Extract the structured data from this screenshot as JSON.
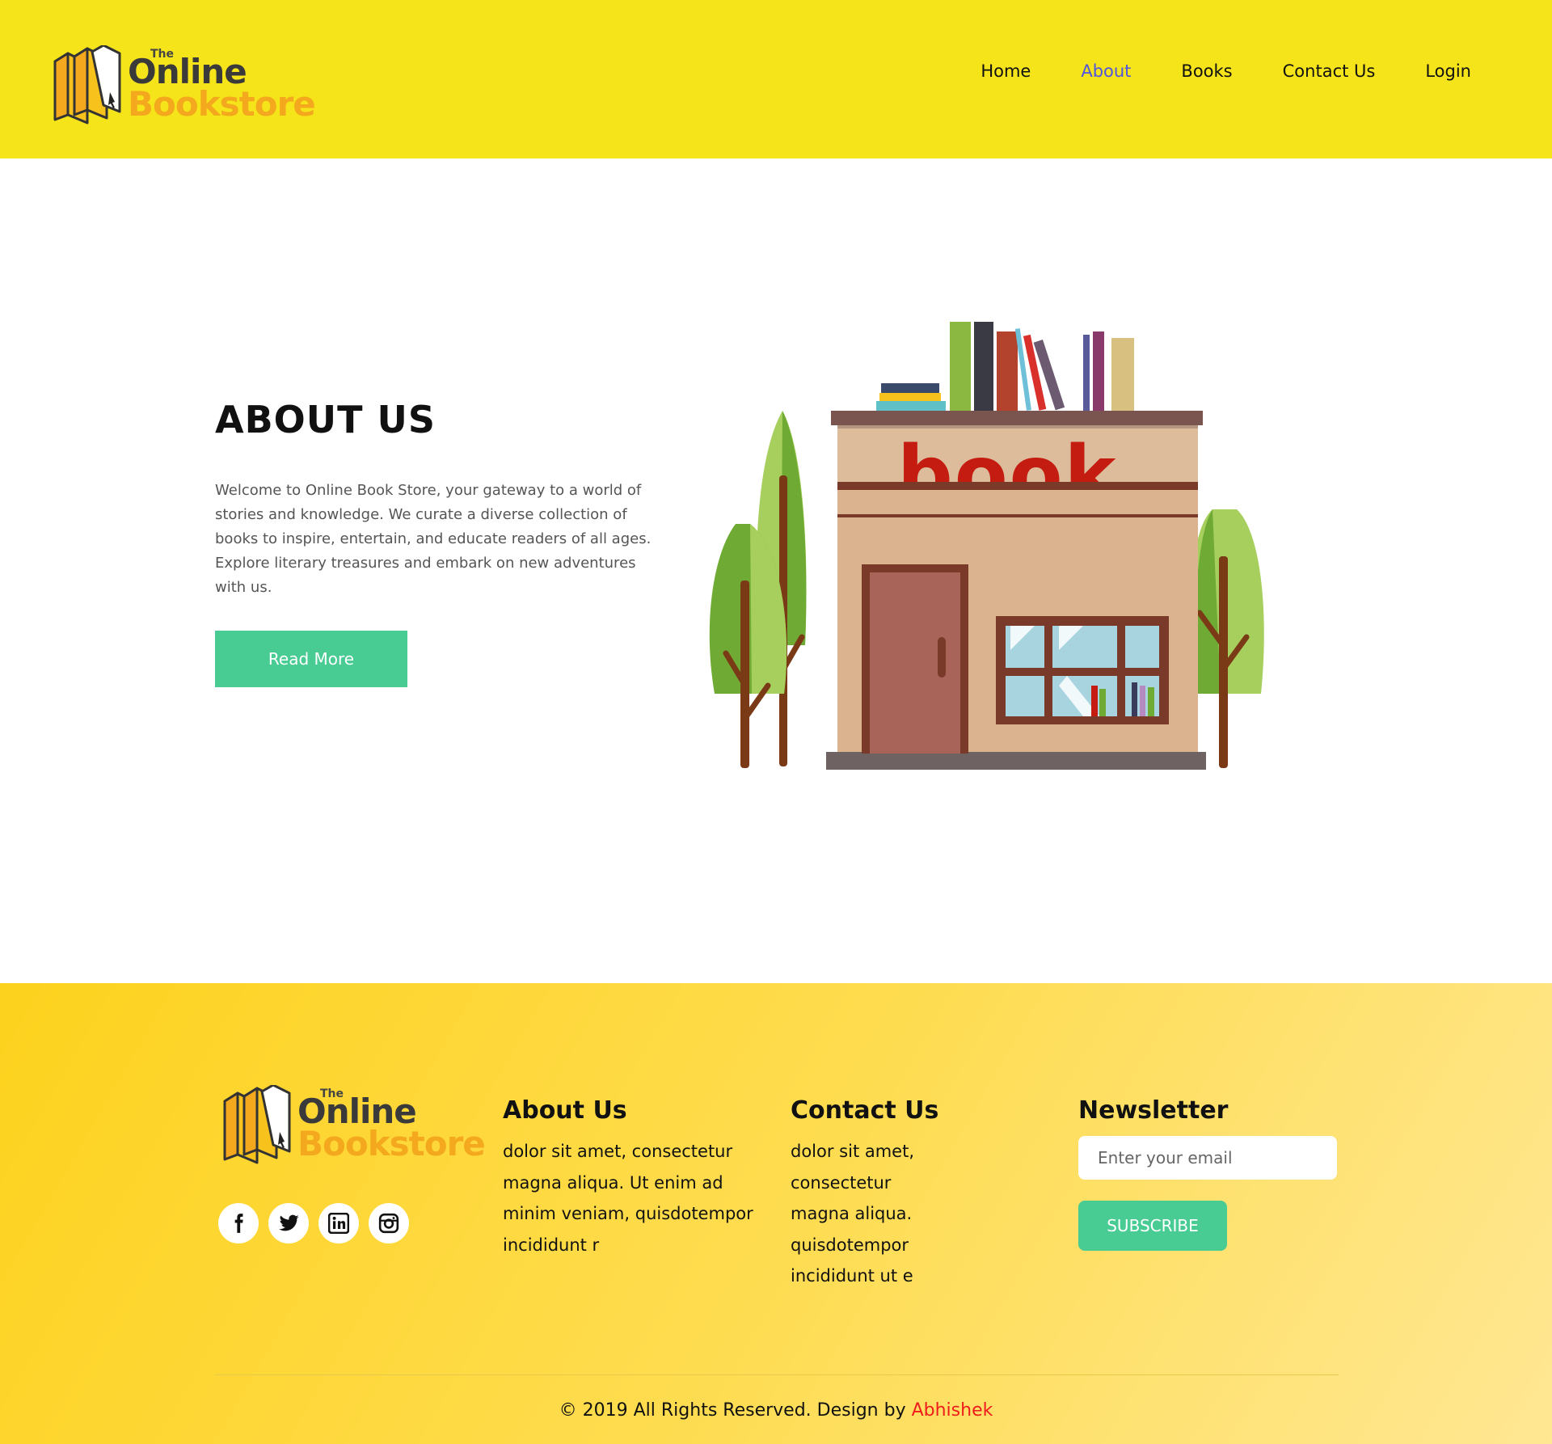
{
  "brand": {
    "the": "The",
    "online": "Online",
    "bookstore": "Bookstore"
  },
  "nav": {
    "items": [
      {
        "label": "Home",
        "active": false
      },
      {
        "label": "About",
        "active": true
      },
      {
        "label": "Books",
        "active": false
      },
      {
        "label": "Contact Us",
        "active": false
      },
      {
        "label": "Login",
        "active": false
      }
    ]
  },
  "about": {
    "title": "ABOUT US",
    "text": "Welcome to Online Book Store, your gateway to a world of stories and knowledge. We curate a diverse collection of books to inspire, entertain, and educate readers of all ages. Explore literary treasures and embark on new adventures with us.",
    "button": "Read More",
    "illustration": {
      "sign": "book"
    }
  },
  "footer": {
    "social": [
      "facebook-icon",
      "twitter-icon",
      "linkedin-icon",
      "instagram-icon"
    ],
    "about": {
      "title": "About Us",
      "text": "dolor sit amet, consectetur magna aliqua. Ut enim ad minim veniam, quisdotempor incididunt r"
    },
    "contact": {
      "title": "Contact Us",
      "text": "dolor sit amet, consectetur magna aliqua. quisdotempor incididunt ut e"
    },
    "newsletter": {
      "title": "Newsletter",
      "placeholder": "Enter your email",
      "button": "SUBSCRIBE"
    },
    "copyright": {
      "text": "© 2019 All Rights Reserved. Design by",
      "author": "Abhishek"
    }
  },
  "colors": {
    "header_bg": "#f5e41a",
    "accent_green": "#48cc93",
    "nav_active": "#4f55e0",
    "logo_orange": "#f4a81d",
    "author_red": "#ee1c1c"
  }
}
